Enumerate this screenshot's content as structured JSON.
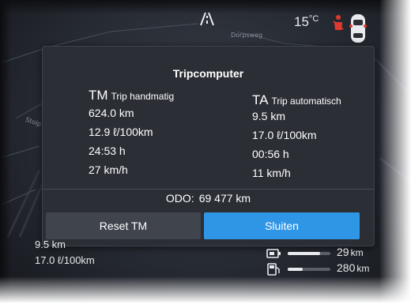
{
  "status": {
    "temperature_value": "15",
    "temperature_unit": "°C",
    "icons": [
      "road-icon",
      "seatbelt-warning-icon",
      "car-top-view-icon"
    ]
  },
  "map": {
    "labels": [
      "Dorpsweg",
      "Stolp"
    ]
  },
  "dialog": {
    "title": "Tripcomputer",
    "tm": {
      "abbr": "TM",
      "description": "Trip handmatig",
      "distance": "624.0 km",
      "consumption": "12.9 ℓ/100km",
      "time": "24:53 h",
      "speed": "27 km/h"
    },
    "ta": {
      "abbr": "TA",
      "description": "Trip automatisch",
      "distance": "9.5 km",
      "consumption": "17.0 ℓ/100km",
      "time": "00:56 h",
      "speed": "11 km/h"
    },
    "odo_label": "ODO:",
    "odo_value": "69 477 km",
    "reset_button": "Reset TM",
    "close_button": "Sluiten",
    "colors": {
      "primary_button": "#2f96e6",
      "secondary_button": "#40444d",
      "panel": "#2b2e35"
    }
  },
  "cluster": {
    "trip_distance": "9.5 km",
    "trip_consumption": "17.0 ℓ/100km",
    "range_electric_value": "29",
    "range_electric_unit": "km",
    "range_electric_fraction": 0.75,
    "range_fuel_value": "280",
    "range_fuel_unit": "km",
    "range_fuel_fraction": 0.35
  }
}
